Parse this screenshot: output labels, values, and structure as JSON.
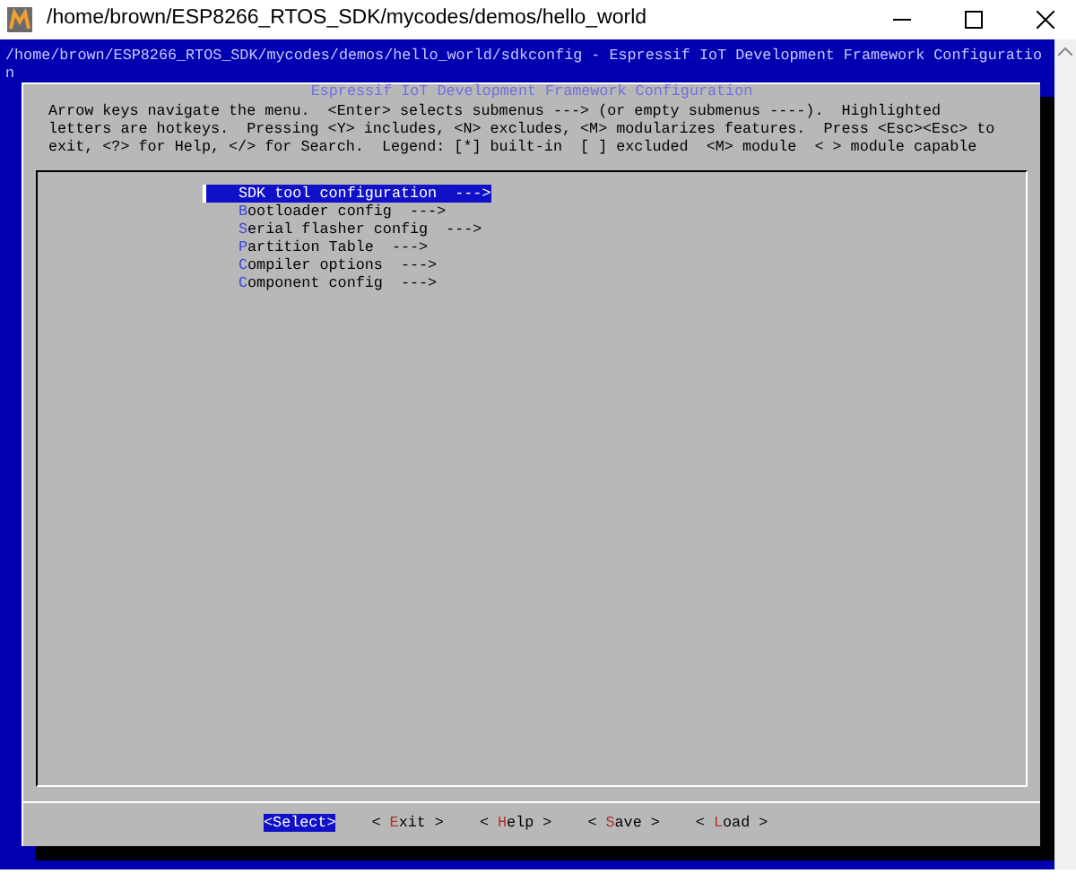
{
  "window": {
    "title": "/home/brown/ESP8266_RTOS_SDK/mycodes/demos/hello_world"
  },
  "terminal": {
    "title": "/home/brown/ESP8266_RTOS_SDK/mycodes/demos/hello_world/sdkconfig - Espressif IoT Development Framework Configuration"
  },
  "dialog": {
    "title": "Espressif IoT Development Framework Configuration",
    "help": "Arrow keys navigate the menu.  <Enter> selects submenus ---> (or empty submenus ----).  Highlighted\nletters are hotkeys.  Pressing <Y> includes, <N> excludes, <M> modularizes features.  Press <Esc><Esc> to\nexit, <?> for Help, </> for Search.  Legend: [*] built-in  [ ] excluded  <M> module  < > module capable",
    "menu": [
      {
        "label": "SDK tool configuration  --->",
        "selected": true
      },
      {
        "label": "Bootloader config  --->",
        "selected": false
      },
      {
        "label": "Serial flasher config  --->",
        "selected": false
      },
      {
        "label": "Partition Table  --->",
        "selected": false
      },
      {
        "label": "Compiler options  --->",
        "selected": false
      },
      {
        "label": "Component config  --->",
        "selected": false
      }
    ],
    "buttons": [
      {
        "label": "<Select>",
        "selected": true
      },
      {
        "label": "< Exit >",
        "selected": false
      },
      {
        "label": "< Help >",
        "selected": false
      },
      {
        "label": "< Save >",
        "selected": false
      },
      {
        "label": "< Load >",
        "selected": false
      }
    ]
  }
}
